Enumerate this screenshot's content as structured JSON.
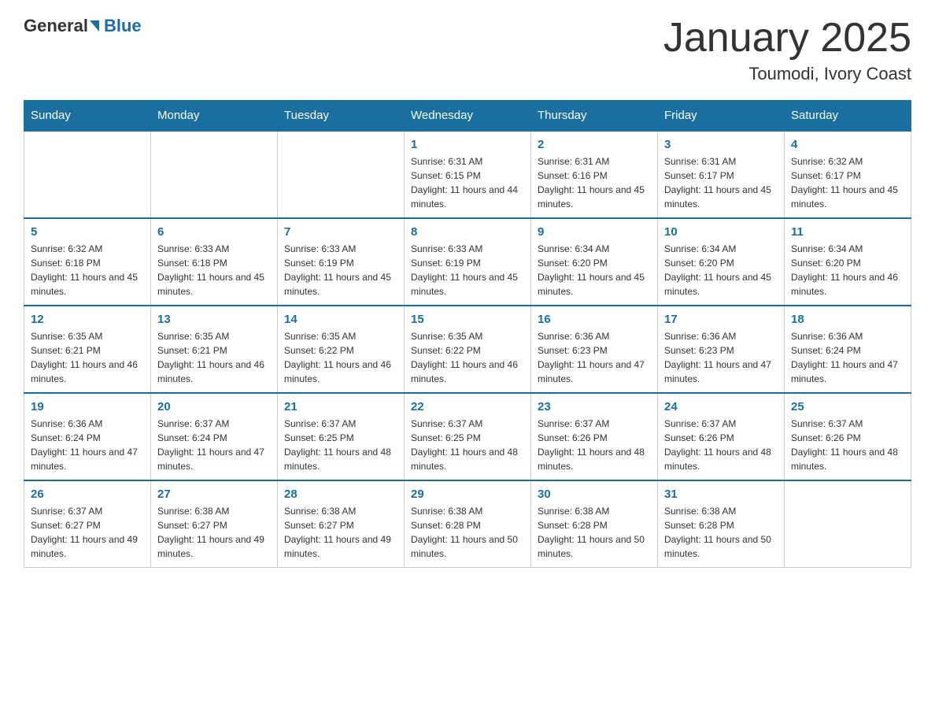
{
  "header": {
    "logo_general": "General",
    "logo_blue": "Blue",
    "month_title": "January 2025",
    "location": "Toumodi, Ivory Coast"
  },
  "weekdays": [
    "Sunday",
    "Monday",
    "Tuesday",
    "Wednesday",
    "Thursday",
    "Friday",
    "Saturday"
  ],
  "weeks": [
    [
      {
        "day": "",
        "info": ""
      },
      {
        "day": "",
        "info": ""
      },
      {
        "day": "",
        "info": ""
      },
      {
        "day": "1",
        "info": "Sunrise: 6:31 AM\nSunset: 6:15 PM\nDaylight: 11 hours and 44 minutes."
      },
      {
        "day": "2",
        "info": "Sunrise: 6:31 AM\nSunset: 6:16 PM\nDaylight: 11 hours and 45 minutes."
      },
      {
        "day": "3",
        "info": "Sunrise: 6:31 AM\nSunset: 6:17 PM\nDaylight: 11 hours and 45 minutes."
      },
      {
        "day": "4",
        "info": "Sunrise: 6:32 AM\nSunset: 6:17 PM\nDaylight: 11 hours and 45 minutes."
      }
    ],
    [
      {
        "day": "5",
        "info": "Sunrise: 6:32 AM\nSunset: 6:18 PM\nDaylight: 11 hours and 45 minutes."
      },
      {
        "day": "6",
        "info": "Sunrise: 6:33 AM\nSunset: 6:18 PM\nDaylight: 11 hours and 45 minutes."
      },
      {
        "day": "7",
        "info": "Sunrise: 6:33 AM\nSunset: 6:19 PM\nDaylight: 11 hours and 45 minutes."
      },
      {
        "day": "8",
        "info": "Sunrise: 6:33 AM\nSunset: 6:19 PM\nDaylight: 11 hours and 45 minutes."
      },
      {
        "day": "9",
        "info": "Sunrise: 6:34 AM\nSunset: 6:20 PM\nDaylight: 11 hours and 45 minutes."
      },
      {
        "day": "10",
        "info": "Sunrise: 6:34 AM\nSunset: 6:20 PM\nDaylight: 11 hours and 45 minutes."
      },
      {
        "day": "11",
        "info": "Sunrise: 6:34 AM\nSunset: 6:20 PM\nDaylight: 11 hours and 46 minutes."
      }
    ],
    [
      {
        "day": "12",
        "info": "Sunrise: 6:35 AM\nSunset: 6:21 PM\nDaylight: 11 hours and 46 minutes."
      },
      {
        "day": "13",
        "info": "Sunrise: 6:35 AM\nSunset: 6:21 PM\nDaylight: 11 hours and 46 minutes."
      },
      {
        "day": "14",
        "info": "Sunrise: 6:35 AM\nSunset: 6:22 PM\nDaylight: 11 hours and 46 minutes."
      },
      {
        "day": "15",
        "info": "Sunrise: 6:35 AM\nSunset: 6:22 PM\nDaylight: 11 hours and 46 minutes."
      },
      {
        "day": "16",
        "info": "Sunrise: 6:36 AM\nSunset: 6:23 PM\nDaylight: 11 hours and 47 minutes."
      },
      {
        "day": "17",
        "info": "Sunrise: 6:36 AM\nSunset: 6:23 PM\nDaylight: 11 hours and 47 minutes."
      },
      {
        "day": "18",
        "info": "Sunrise: 6:36 AM\nSunset: 6:24 PM\nDaylight: 11 hours and 47 minutes."
      }
    ],
    [
      {
        "day": "19",
        "info": "Sunrise: 6:36 AM\nSunset: 6:24 PM\nDaylight: 11 hours and 47 minutes."
      },
      {
        "day": "20",
        "info": "Sunrise: 6:37 AM\nSunset: 6:24 PM\nDaylight: 11 hours and 47 minutes."
      },
      {
        "day": "21",
        "info": "Sunrise: 6:37 AM\nSunset: 6:25 PM\nDaylight: 11 hours and 48 minutes."
      },
      {
        "day": "22",
        "info": "Sunrise: 6:37 AM\nSunset: 6:25 PM\nDaylight: 11 hours and 48 minutes."
      },
      {
        "day": "23",
        "info": "Sunrise: 6:37 AM\nSunset: 6:26 PM\nDaylight: 11 hours and 48 minutes."
      },
      {
        "day": "24",
        "info": "Sunrise: 6:37 AM\nSunset: 6:26 PM\nDaylight: 11 hours and 48 minutes."
      },
      {
        "day": "25",
        "info": "Sunrise: 6:37 AM\nSunset: 6:26 PM\nDaylight: 11 hours and 48 minutes."
      }
    ],
    [
      {
        "day": "26",
        "info": "Sunrise: 6:37 AM\nSunset: 6:27 PM\nDaylight: 11 hours and 49 minutes."
      },
      {
        "day": "27",
        "info": "Sunrise: 6:38 AM\nSunset: 6:27 PM\nDaylight: 11 hours and 49 minutes."
      },
      {
        "day": "28",
        "info": "Sunrise: 6:38 AM\nSunset: 6:27 PM\nDaylight: 11 hours and 49 minutes."
      },
      {
        "day": "29",
        "info": "Sunrise: 6:38 AM\nSunset: 6:28 PM\nDaylight: 11 hours and 50 minutes."
      },
      {
        "day": "30",
        "info": "Sunrise: 6:38 AM\nSunset: 6:28 PM\nDaylight: 11 hours and 50 minutes."
      },
      {
        "day": "31",
        "info": "Sunrise: 6:38 AM\nSunset: 6:28 PM\nDaylight: 11 hours and 50 minutes."
      },
      {
        "day": "",
        "info": ""
      }
    ]
  ]
}
